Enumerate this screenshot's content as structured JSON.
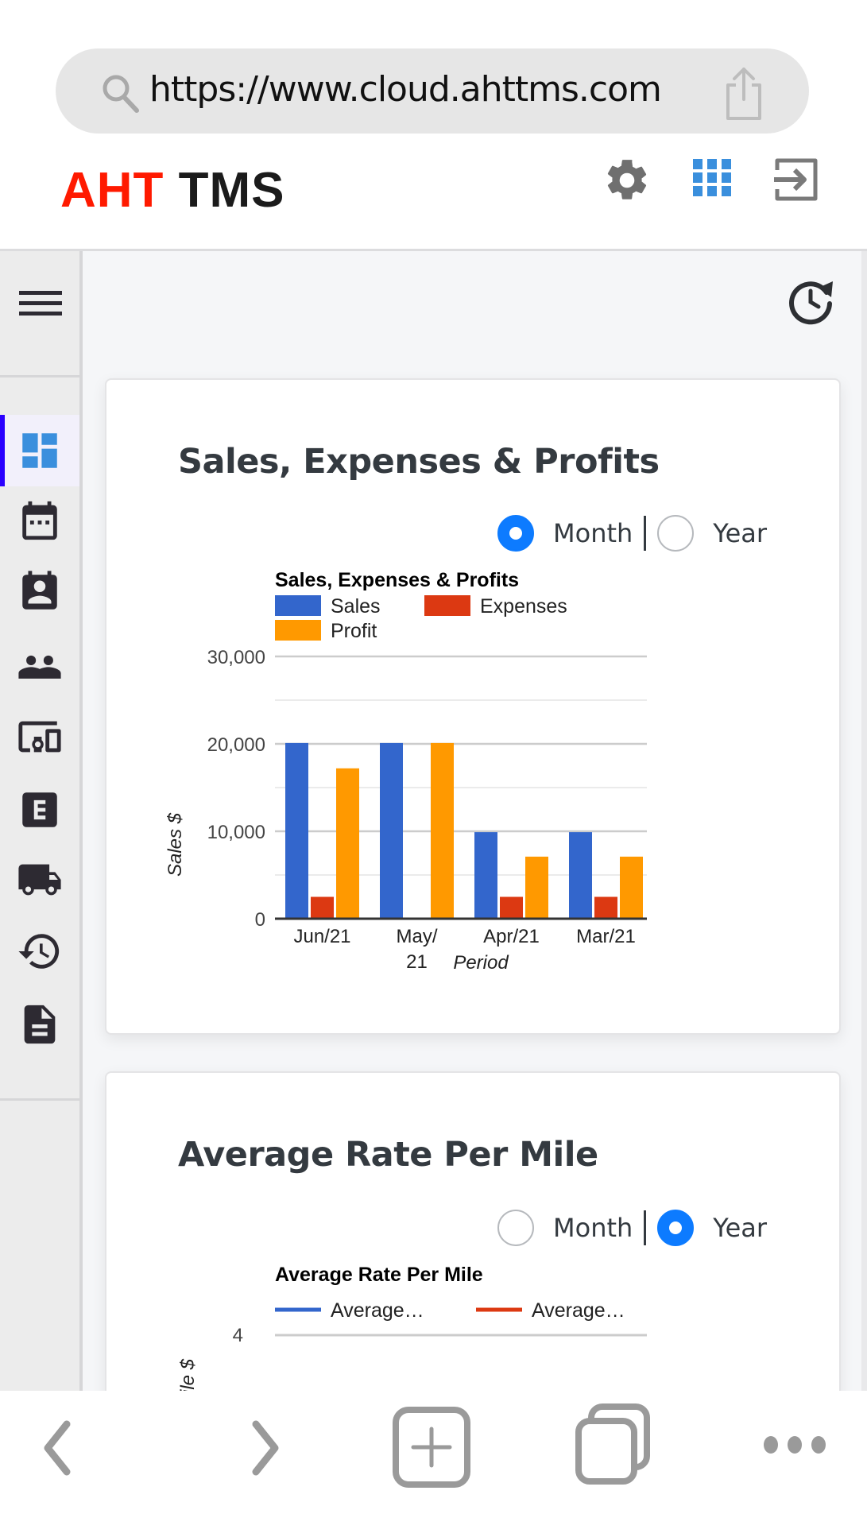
{
  "browser": {
    "url": "https://www.cloud.ahttms.com",
    "icons": {
      "search": "search-icon",
      "share": "share-icon"
    },
    "bottom_nav": [
      "back-icon",
      "forward-icon",
      "new-tab-icon",
      "tabs-icon",
      "more-icon"
    ]
  },
  "header": {
    "brand_part1": "AHT",
    "brand_part2": "TMS",
    "brand_color1": "#ff1a00",
    "brand_color2": "#1b1b1b",
    "icons": [
      "gear-icon",
      "apps-grid-icon",
      "logout-icon"
    ]
  },
  "sidebar": {
    "menu_icon": "hamburger-icon",
    "items": [
      {
        "icon": "dashboard-icon",
        "active": true
      },
      {
        "icon": "calendar-icon",
        "active": false
      },
      {
        "icon": "contact-calendar-icon",
        "active": false
      },
      {
        "icon": "people-icon",
        "active": false
      },
      {
        "icon": "devices-icon",
        "active": false
      },
      {
        "icon": "e-box-icon",
        "active": false
      },
      {
        "icon": "truck-icon",
        "active": false
      },
      {
        "icon": "history-icon",
        "active": false
      },
      {
        "icon": "document-icon",
        "active": false
      }
    ],
    "active_color": "#2a00ff"
  },
  "main": {
    "refresh_icon": "clock-refresh-icon",
    "cards": [
      {
        "title": "Sales, Expenses & Profits",
        "toggle": {
          "month_label": "Month",
          "year_label": "Year",
          "selected": "Month"
        }
      },
      {
        "title": "Average Rate Per Mile",
        "toggle": {
          "month_label": "Month",
          "year_label": "Year",
          "selected": "Year"
        }
      }
    ]
  },
  "chart_data": [
    {
      "type": "bar",
      "title": "Sales, Expenses & Profits",
      "categories": [
        "Jun/21",
        "May/21",
        "Apr/21",
        "Mar/21"
      ],
      "category_labels": [
        [
          "Jun/21"
        ],
        [
          "May/",
          "21"
        ],
        [
          "Apr/21"
        ],
        [
          "Mar/21"
        ]
      ],
      "series": [
        {
          "name": "Sales",
          "color": "#3366cc",
          "values": [
            20100,
            20100,
            9900,
            9900
          ]
        },
        {
          "name": "Expenses",
          "color": "#dc3912",
          "values": [
            2500,
            0,
            2500,
            2500
          ]
        },
        {
          "name": "Profit",
          "color": "#ff9900",
          "values": [
            17200,
            20100,
            7100,
            7100
          ]
        }
      ],
      "xlabel": "Period",
      "ylabel": "Sales $",
      "ylim": [
        0,
        30000
      ],
      "yticks": [
        0,
        10000,
        20000,
        30000
      ],
      "ytick_labels": [
        "0",
        "10,000",
        "20,000",
        "30,000"
      ],
      "minor_grid": [
        5000,
        15000,
        25000
      ],
      "grid": true,
      "legend": "top"
    },
    {
      "type": "line",
      "title": "Average Rate Per Mile",
      "series": [
        {
          "name": "Average…",
          "color": "#3366cc",
          "values": []
        },
        {
          "name": "Average…",
          "color": "#dc3912",
          "values": []
        }
      ],
      "ylabel": "Rate Per Mile $",
      "ylabel_visible": "ile $",
      "yticks": [
        4
      ],
      "ytick_labels": [
        "4"
      ],
      "grid": true,
      "legend": "top"
    }
  ]
}
